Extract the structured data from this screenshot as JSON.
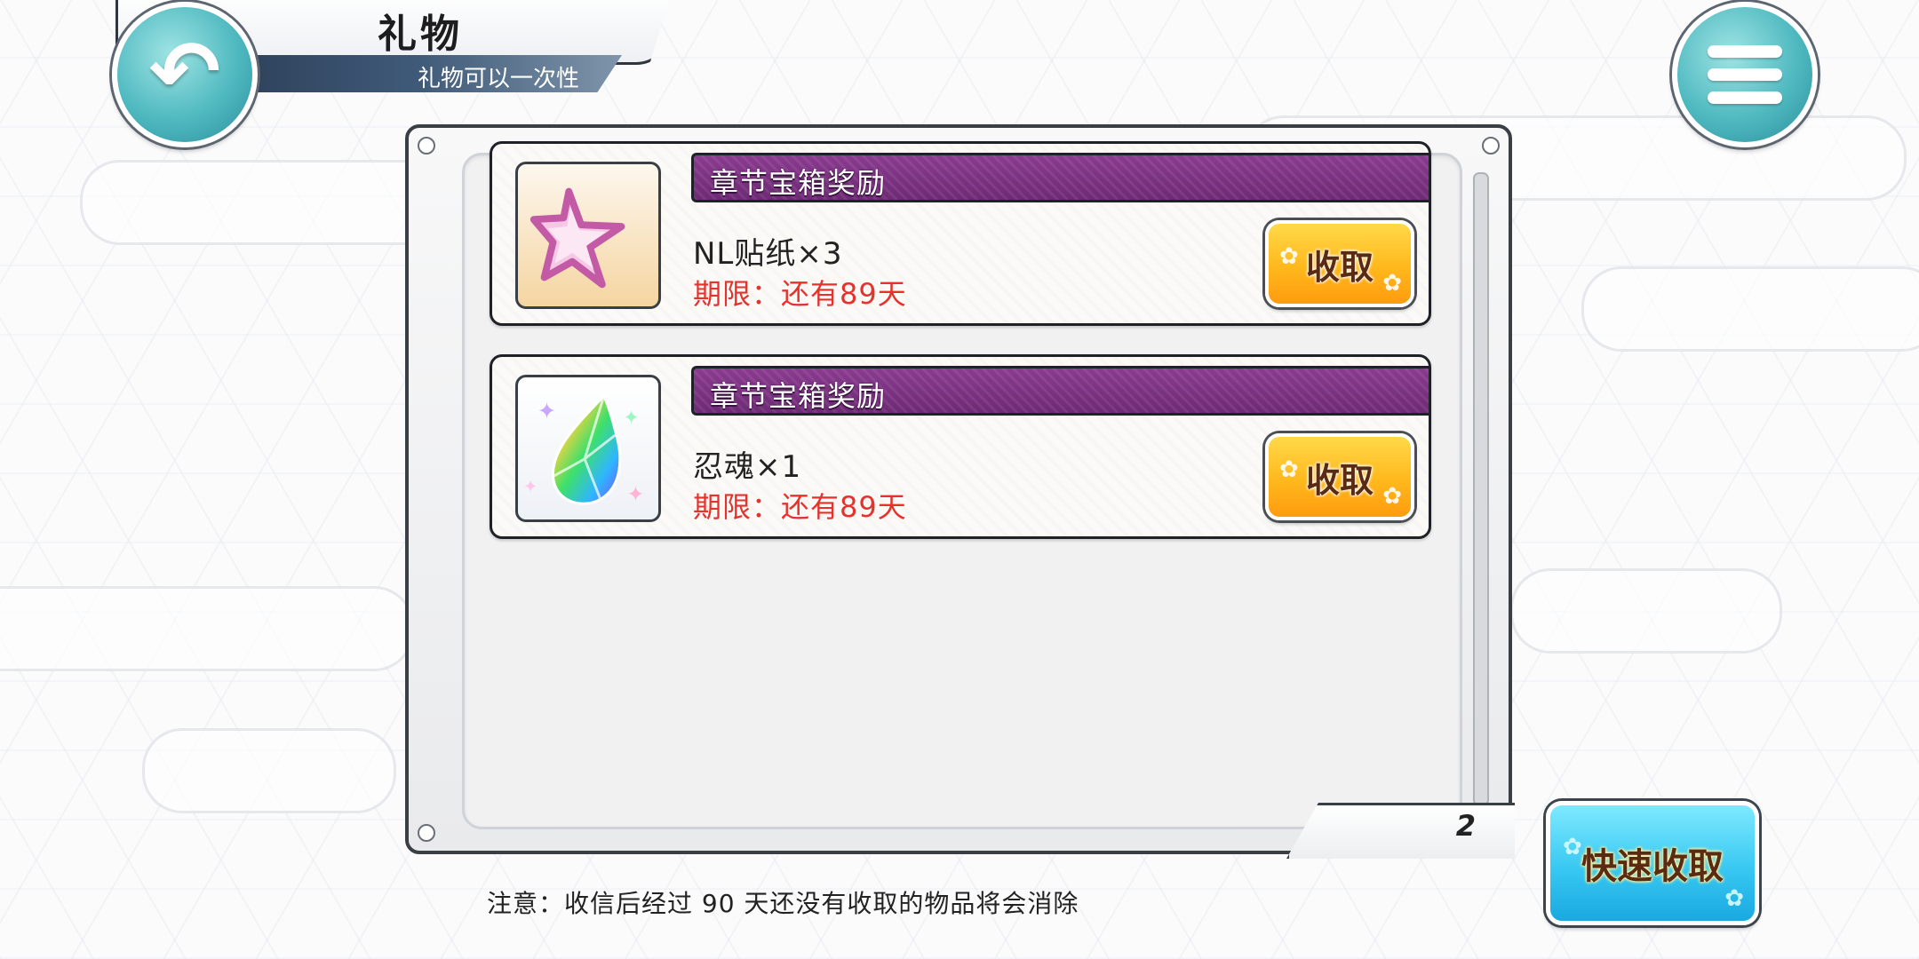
{
  "header": {
    "title": "礼物",
    "subtitle": "礼物可以一次性"
  },
  "buttons": {
    "back_icon": "back-arrow-icon",
    "menu_icon": "hamburger-menu-icon",
    "quick_collect": "快速收取"
  },
  "gifts": [
    {
      "source": "章节宝箱奖励",
      "item": "NL贴纸×3",
      "expiry": "期限：还有89天",
      "icon": "pink-star-icon",
      "action": "收取"
    },
    {
      "source": "章节宝箱奖励",
      "item": "忍魂×1",
      "expiry": "期限：还有89天",
      "icon": "rainbow-gem-icon",
      "action": "收取"
    }
  ],
  "pagination": {
    "page": "2"
  },
  "notice": "注意：收信后经过 90 天还没有收取的物品将会消除",
  "colors": {
    "header_purple": "#7a3181",
    "expiry_red": "#e5322d",
    "collect_orange": "#ffb81c",
    "quick_cyan": "#38c8f2",
    "round_teal": "#4fb9c0"
  }
}
